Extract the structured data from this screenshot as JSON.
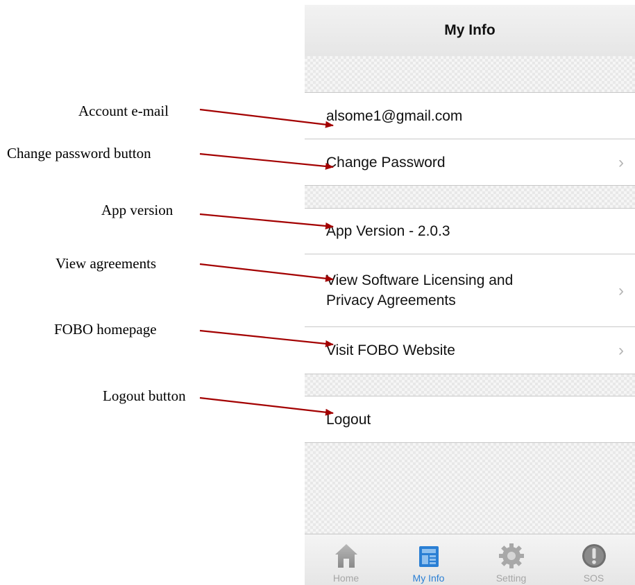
{
  "annotations": {
    "account_email": "Account e-mail",
    "change_password": "Change password button",
    "app_version": "App version",
    "view_agreements": "View agreements",
    "fobo_homepage": "FOBO homepage",
    "logout": "Logout button"
  },
  "navbar": {
    "title": "My Info"
  },
  "rows": {
    "email": "alsome1@gmail.com",
    "change_password": "Change Password",
    "app_version": "App Version - 2.0.3",
    "agreements_line1": "View Software Licensing and",
    "agreements_line2": "Privacy Agreements",
    "website": "Visit FOBO Website",
    "logout": "Logout"
  },
  "chevron_glyph": "›",
  "tabbar": {
    "home": "Home",
    "my_info": "My Info",
    "setting": "Setting",
    "sos": "SOS",
    "active_tab": "My Info",
    "active_color": "#2a7fd4"
  },
  "arrow_color": "#a30000"
}
